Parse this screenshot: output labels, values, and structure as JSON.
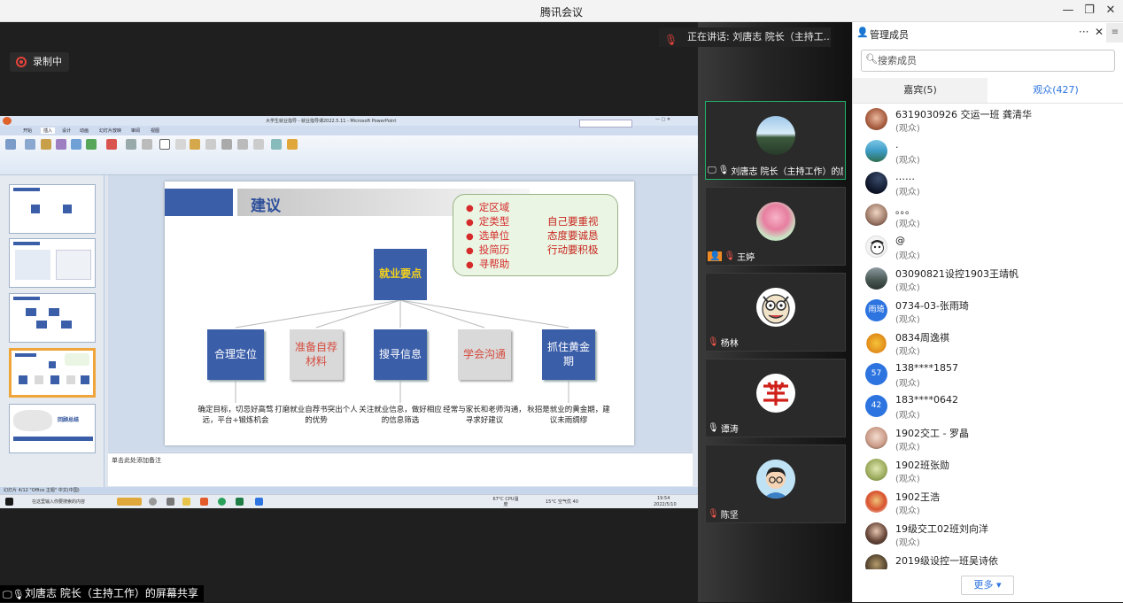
{
  "window": {
    "title": "腾讯会议",
    "minimize": "—",
    "restore": "❐",
    "close": "✕"
  },
  "stage": {
    "recording_label": "录制中",
    "speaking_label": "正在讲话: 刘唐志 院长（主持工...",
    "share_label": "刘唐志 院长（主持工作）的屏幕共享"
  },
  "shared_screen": {
    "ppt_title": "大学生就业指导 - 就业指导课2022.5.11 - Microsoft PowerPoint",
    "ribbon_tabs": [
      "开始",
      "插入",
      "设计",
      "动画",
      "幻灯片放映",
      "审阅",
      "视图"
    ],
    "notes_placeholder": "单击此处添加备注",
    "status_text": "幻灯片 4/12   \"Office 主题\"   中文(中国)",
    "taskbar_search": "在这里输入你要搜索的内容",
    "taskbar_cpu": "67°C CPU温度",
    "taskbar_weather": "15°C 空气优 40",
    "taskbar_time": "19:54",
    "taskbar_date": "2022/5/10",
    "thumb5_label": "回顾总结",
    "slide": {
      "title": "建议",
      "left_list": [
        "定区域",
        "定类型",
        "选单位",
        "投简历",
        "寻帮助"
      ],
      "right_list": [
        "自己要重视",
        "态度要诚恳",
        "行动要积极"
      ],
      "core": "就业要点",
      "boxes": [
        {
          "label": "合理定位",
          "desc": "确定目标，切忌好高骛远，平台+锻炼机会"
        },
        {
          "label": "准备自荐材料",
          "desc": "打磨就业自荐书突出个人的优势"
        },
        {
          "label": "搜寻信息",
          "desc": "关注就业信息，做好相应的信息筛选"
        },
        {
          "label": "学会沟通",
          "desc": "经常与家长和老师沟通，寻求好建议"
        },
        {
          "label": "抓住黄金期",
          "desc": "秋招是就业的黄金期，建议未雨绸缪"
        }
      ]
    }
  },
  "video_tiles": [
    {
      "name": "刘唐志 院长（主持工作）的屏...",
      "icon": "screen-share-icon"
    },
    {
      "name": "王婷",
      "icon": "person-icon"
    },
    {
      "name": "杨林",
      "icon": "mic-muted-icon"
    },
    {
      "name": "谭涛",
      "icon": "mic-icon"
    },
    {
      "name": "陈坚",
      "icon": "mic-muted-icon"
    }
  ],
  "members_panel": {
    "title": "管理成员",
    "more_icon": "···",
    "close_icon": "✕",
    "search_placeholder": "搜索成员",
    "tabs": {
      "guests": "嘉宾(5)",
      "audience": "观众(427)"
    },
    "members": [
      {
        "name": "6319030926 交运一班 龚清华",
        "role": "(观众)",
        "avatar_text": ""
      },
      {
        "name": ".",
        "role": "(观众)",
        "avatar_text": ""
      },
      {
        "name": "……",
        "role": "(观众)",
        "avatar_text": ""
      },
      {
        "name": "。。。",
        "role": "(观众)",
        "avatar_text": ""
      },
      {
        "name": "@",
        "role": "(观众)",
        "avatar_text": ""
      },
      {
        "name": "03090821设控1903王靖帆",
        "role": "(观众)",
        "avatar_text": ""
      },
      {
        "name": "0734-03-张雨琦",
        "role": "(观众)",
        "avatar_text": "雨琦"
      },
      {
        "name": "0834周逸祺",
        "role": "(观众)",
        "avatar_text": ""
      },
      {
        "name": "138****1857",
        "role": "(观众)",
        "avatar_text": "57"
      },
      {
        "name": "183****0642",
        "role": "(观众)",
        "avatar_text": "42"
      },
      {
        "name": "1902交工 - 罗晶",
        "role": "(观众)",
        "avatar_text": ""
      },
      {
        "name": "1902班张勋",
        "role": "(观众)",
        "avatar_text": ""
      },
      {
        "name": "1902王浩",
        "role": "(观众)",
        "avatar_text": ""
      },
      {
        "name": "19级交工02班刘向洋",
        "role": "(观众)",
        "avatar_text": ""
      },
      {
        "name": "2019级设控一班吴诗依",
        "role": "(观众)",
        "avatar_text": ""
      }
    ],
    "more_button": "更多 ▾"
  },
  "colors": {
    "accent_blue": "#2d74e0",
    "record_red": "#e5433b",
    "slide_blue": "#3b5ea9",
    "active_green": "#23b36a"
  }
}
